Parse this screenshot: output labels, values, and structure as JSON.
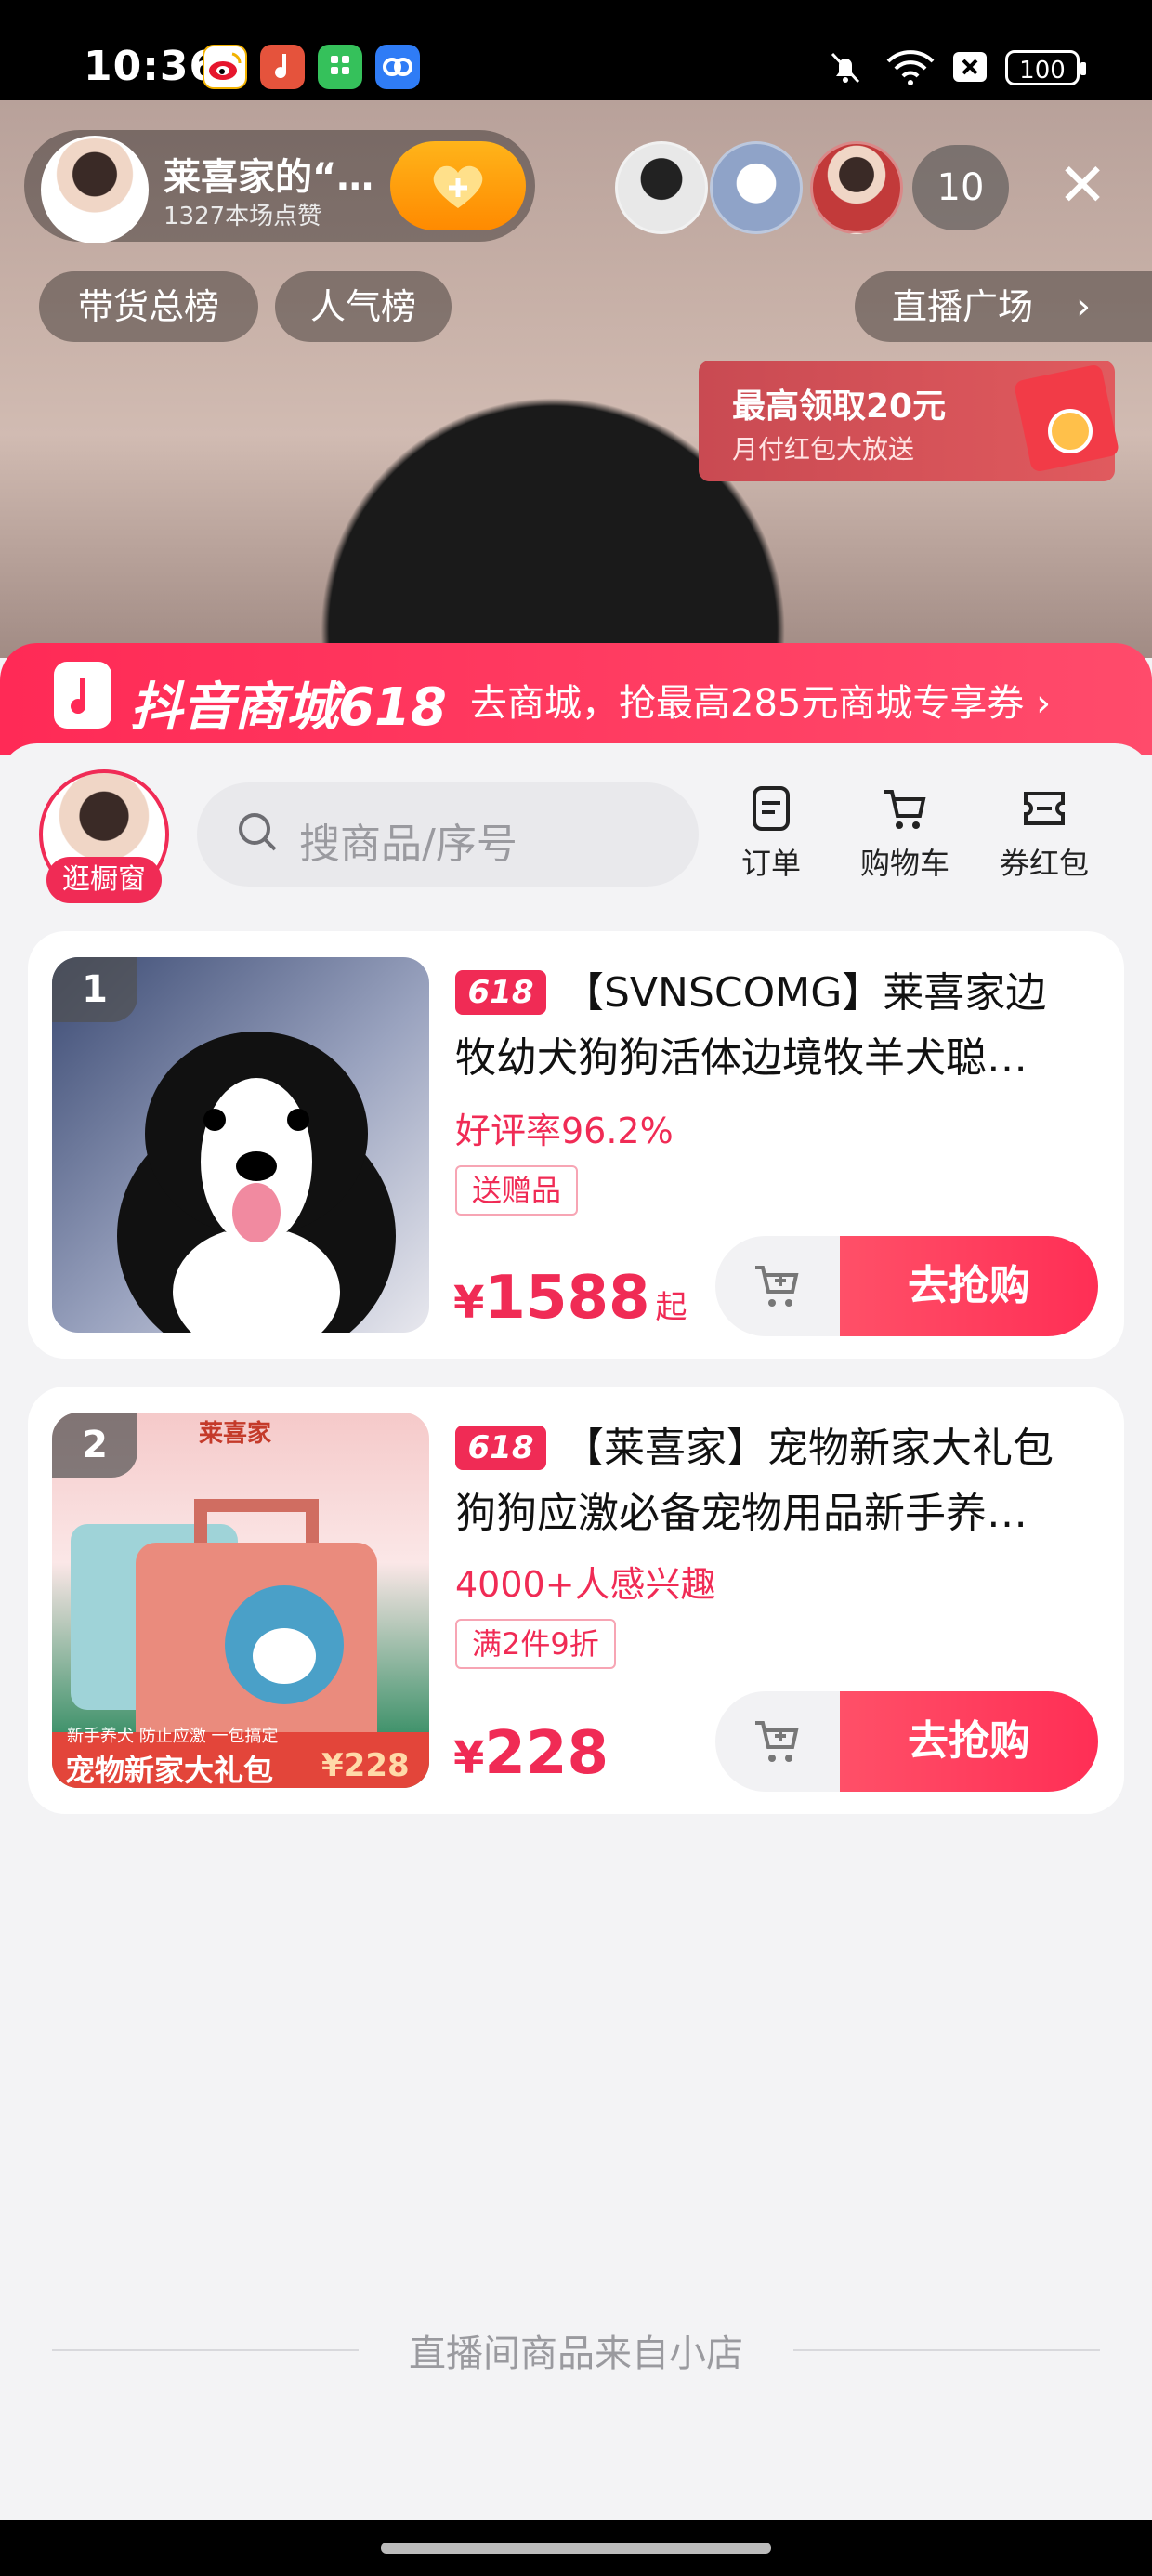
{
  "status_bar": {
    "time": "10:36",
    "battery": "100",
    "apps": [
      "weibo-icon",
      "music-icon",
      "green-app-icon",
      "cloud-icon"
    ],
    "system": [
      "mute-icon",
      "wifi-icon",
      "close-box-icon"
    ]
  },
  "live": {
    "anchor_name": "莱喜家的“…",
    "anchor_likes": "1327本场点赞",
    "viewer_count": "10",
    "rank_tabs": [
      "带货总榜",
      "人气榜"
    ],
    "plaza_label": "直播广场",
    "redpacket": {
      "title": "最高领取20元",
      "subtitle": "月付红包大放送"
    }
  },
  "mall": {
    "title": "抖音商城618",
    "promo": "去商城，抢最高285元商城专享券",
    "shop_badge": "逛橱窗",
    "search_placeholder": "搜商品/序号",
    "tools": [
      "订单",
      "购物车",
      "券红包"
    ]
  },
  "products": [
    {
      "rank": "1",
      "tag": "618",
      "title_line1": "【SVNSCOMG】莱喜家边",
      "title_line2": "牧幼犬狗狗活体边境牧羊犬聪…",
      "rating": "好评率96.2%",
      "chip": "送赠品",
      "currency": "¥",
      "price": "1588",
      "price_suffix": "起",
      "buy_label": "去抢购"
    },
    {
      "rank": "2",
      "tag": "618",
      "title_line1": "【莱喜家】宠物新家大礼包",
      "title_line2": "狗狗应激必备宠物用品新手养…",
      "rating": "4000+人感兴趣",
      "chip": "满2件9折",
      "currency": "¥",
      "price": "228",
      "price_suffix": "",
      "buy_label": "去抢购",
      "image_text_top": "莱喜家",
      "image_text_bottom": "宠物新家大礼包",
      "image_text_sub": "新手养犬 防止应激 一包搞定",
      "image_price": "¥228"
    }
  ],
  "footer": "直播间商品来自小店",
  "colors": {
    "brand": "#f02b55",
    "follow": "#ff9a00"
  }
}
